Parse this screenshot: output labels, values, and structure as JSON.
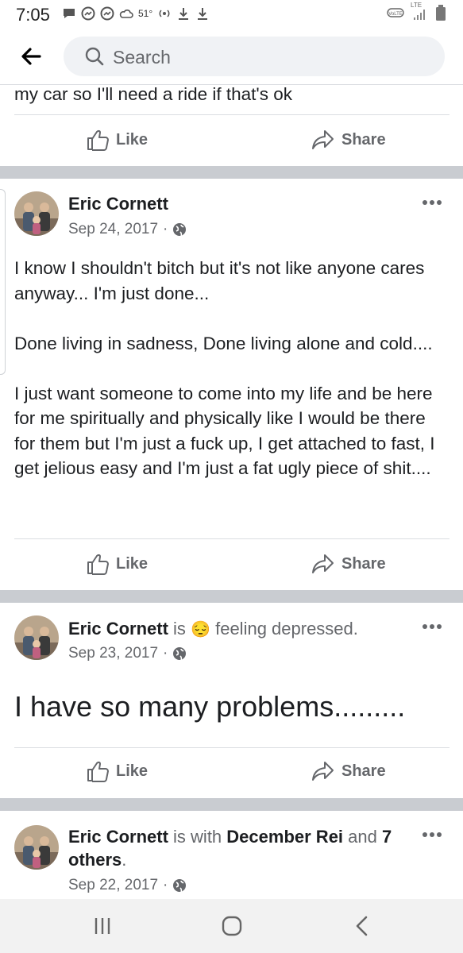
{
  "status_bar": {
    "time": "7:05",
    "temperature": "51°",
    "network": "LTE",
    "icons": [
      "chat-icon",
      "messenger-icon",
      "messenger-icon",
      "cloud-icon",
      "hotspot-icon",
      "download-icon",
      "download-icon",
      "volte-icon",
      "signal-icon",
      "battery-icon"
    ]
  },
  "search": {
    "placeholder": "Search"
  },
  "prev_post": {
    "text_fragment": "my car so I'll need a ride if that's ok",
    "like_label": "Like",
    "share_label": "Share"
  },
  "posts": [
    {
      "author": "Eric Cornett",
      "date": "Sep 24, 2017",
      "separator": "·",
      "privacy_icon": "globe-icon",
      "text": "I know I shouldn't bitch but it's not like anyone cares anyway... I'm just done...\n\nDone living in sadness, Done living alone and cold....\n\nI just want someone to come into my life and be here for me spiritually and physically like I would be there for them but I'm just a fuck up, I get attached to fast, I get jelious easy and I'm just a fat ugly piece of shit....",
      "like_label": "Like",
      "share_label": "Share"
    },
    {
      "author": "Eric Cornett",
      "connector": "is",
      "emoji": "😔",
      "feeling": "feeling depressed.",
      "date": "Sep 23, 2017",
      "separator": "·",
      "privacy_icon": "globe-icon",
      "text": "I have so many problems.........",
      "like_label": "Like",
      "share_label": "Share"
    },
    {
      "author": "Eric Cornett",
      "connector": "is with",
      "tagged": "December Rei",
      "and_word": "and",
      "others": "7 others",
      "period": ".",
      "date": "Sep 22, 2017",
      "separator": "·",
      "privacy_icon": "globe-icon"
    }
  ],
  "nav": {
    "icons": [
      "recents-icon",
      "home-icon",
      "back-icon"
    ]
  },
  "colors": {
    "divider": "#c9ccd1",
    "muted_text": "#65676b",
    "text": "#1c1e21",
    "search_bg": "#f0f2f5"
  }
}
